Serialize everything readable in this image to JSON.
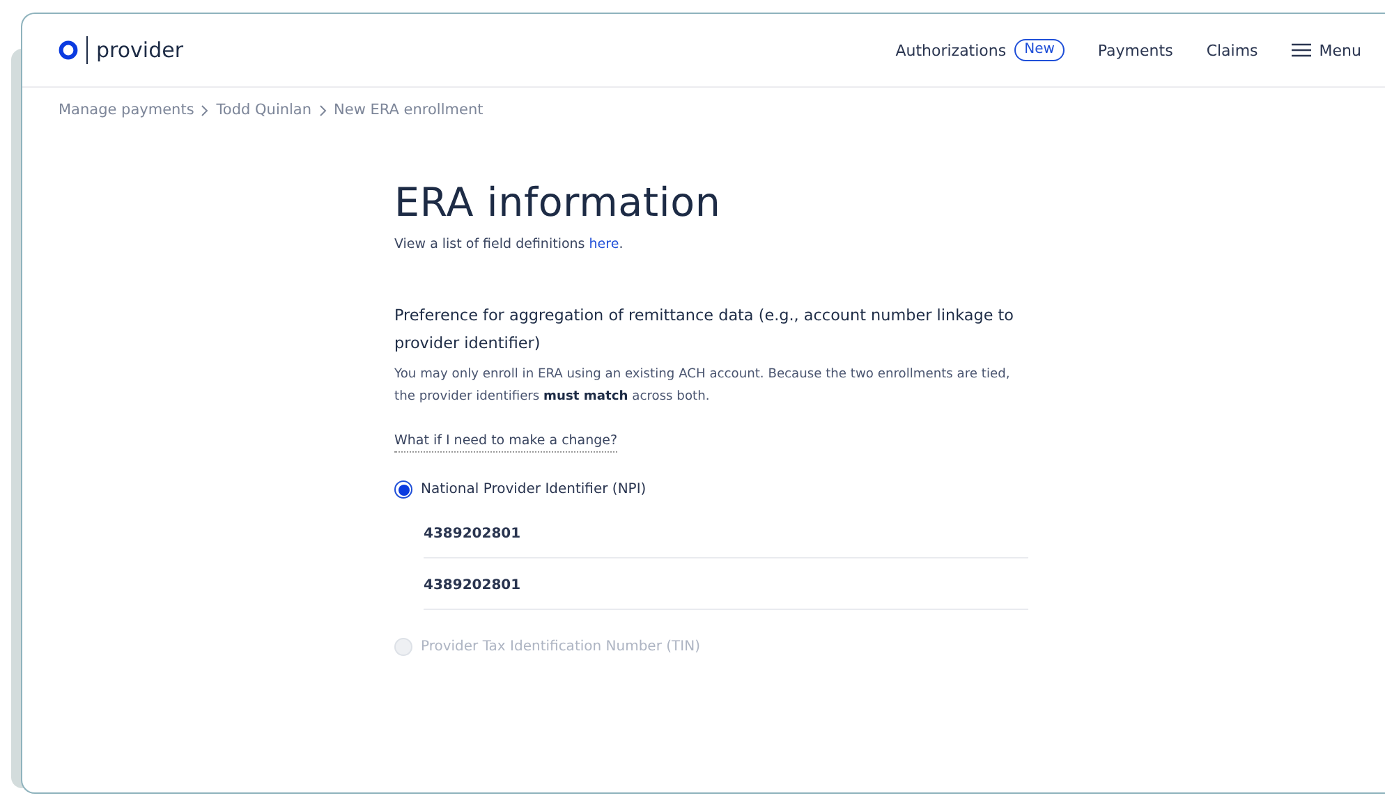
{
  "header": {
    "brand": "provider",
    "nav": [
      {
        "label": "Authorizations",
        "badge": "New"
      },
      {
        "label": "Payments"
      },
      {
        "label": "Claims"
      }
    ],
    "menu": "Menu"
  },
  "breadcrumbs": [
    "Manage payments",
    "Todd Quinlan",
    "New ERA enrollment"
  ],
  "title": "ERA information",
  "intro": {
    "text": "View a list of field definitions ",
    "link": "here",
    "after": "."
  },
  "section": {
    "heading": "Preference for aggregation of remittance data (e.g., account number linkage to provider identifier)",
    "note": "You may only enroll in ERA using an existing ACH account. Because the two enrollments are tied, the provider identifiers **must match** across both.",
    "help_link": "What if I need to make a change?"
  },
  "options": [
    {
      "label": "National Provider Identifier (NPI)",
      "selected": true,
      "disabled": false,
      "fields": [
        "4389202801",
        "4389202801"
      ]
    },
    {
      "label": "Provider Tax Identification Number (TIN)",
      "selected": false,
      "disabled": true
    }
  ]
}
